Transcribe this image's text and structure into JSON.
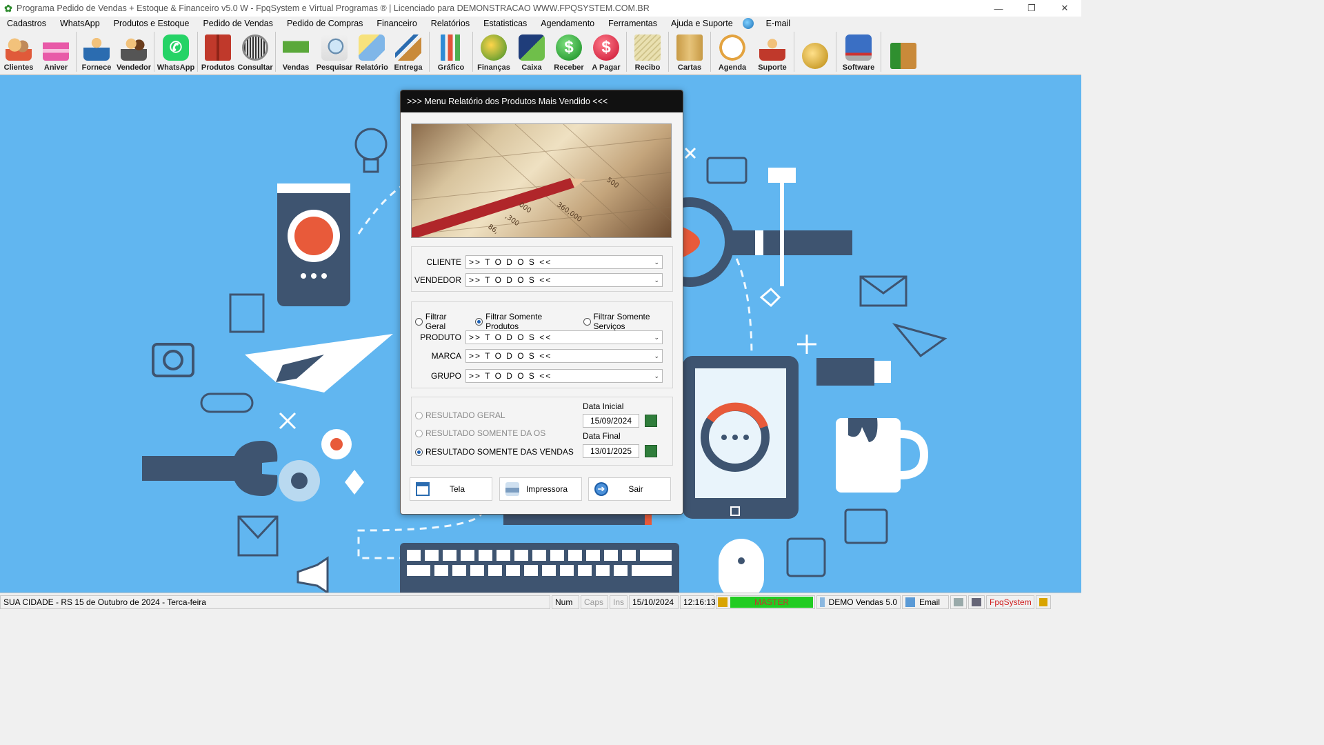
{
  "window": {
    "title": "Programa Pedido de Vendas + Estoque & Financeiro v5.0 W - FpqSystem e Virtual Programas ® | Licenciado para  DEMONSTRACAO WWW.FPQSYSTEM.COM.BR",
    "controls": [
      "—",
      "❐",
      "✕"
    ]
  },
  "menu": [
    "Cadastros",
    "WhatsApp",
    "Produtos e Estoque",
    "Pedido de Vendas",
    "Pedido de Compras",
    "Financeiro",
    "Relatórios",
    "Estatisticas",
    "Agendamento",
    "Ferramentas",
    "Ajuda e Suporte",
    "E-mail"
  ],
  "toolbar": {
    "clientes": "Clientes",
    "aniver": "Aniver",
    "fornece": "Fornece",
    "vendedor": "Vendedor",
    "whatsapp": "WhatsApp",
    "produtos": "Produtos",
    "consultar": "Consultar",
    "vendas": "Vendas",
    "pesquisar": "Pesquisar",
    "relatorio": "Relatório",
    "entrega": "Entrega",
    "grafico": "Gráfico",
    "financas": "Finanças",
    "caixa": "Caixa",
    "receber": "Receber",
    "apagar": "A Pagar",
    "recibo": "Recibo",
    "cartas": "Cartas",
    "agenda": "Agenda",
    "suporte": "Suporte",
    "software": "Software"
  },
  "colors": {
    "desktop": "#61b6f0",
    "dialog_title_bg": "#111111",
    "master_green": "#22cc22"
  },
  "dialog": {
    "title": ">>> Menu Relatório dos Produtos Mais Vendido <<<",
    "image_numbers": [
      "500",
      "360,000",
      ",300",
      "000",
      "86,"
    ],
    "cliente": {
      "label": "CLIENTE",
      "value": ">> T O D O S <<"
    },
    "vendedor": {
      "label": "VENDEDOR",
      "value": ">> T O D O S <<"
    },
    "filtros": {
      "geral": "Filtrar Geral",
      "produtos": "Filtrar Somente Produtos",
      "servicos": "Filtrar Somente Serviços",
      "selected": "produtos"
    },
    "produto": {
      "label": "PRODUTO",
      "value": ">> T O D O S <<"
    },
    "marca": {
      "label": "MARCA",
      "value": ">> T O D O S <<"
    },
    "grupo": {
      "label": "GRUPO",
      "value": ">> T O D O S <<"
    },
    "resultados": {
      "geral": "RESULTADO GERAL",
      "os": "RESULTADO SOMENTE DA OS",
      "vendas": "RESULTADO SOMENTE DAS VENDAS",
      "selected": "vendas"
    },
    "data_inicial": {
      "label": "Data Inicial",
      "value": "15/09/2024"
    },
    "data_final": {
      "label": "Data Final",
      "value": "13/01/2025"
    },
    "buttons": {
      "tela": "Tela",
      "impressora": "Impressora",
      "sair": "Sair"
    }
  },
  "statusbar": {
    "location": "SUA CIDADE - RS 15 de Outubro de 2024 - Terca-feira",
    "num": "Num",
    "caps": "Caps",
    "ins": "Ins",
    "date": "15/10/2024",
    "time": "12:16:13",
    "user": "MASTER",
    "version": "DEMO Vendas 5.0",
    "email": "Email",
    "brand": "FpqSystem"
  }
}
